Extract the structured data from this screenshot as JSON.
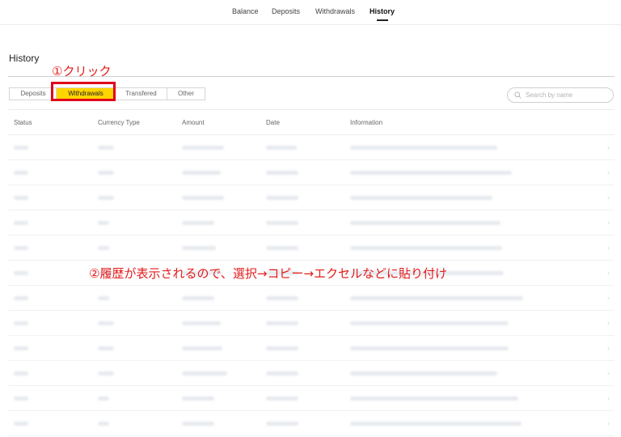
{
  "nav": {
    "tabs": [
      {
        "label": "Balance"
      },
      {
        "label": "Deposits"
      },
      {
        "label": "Withdrawals"
      },
      {
        "label": "History",
        "active": true
      }
    ]
  },
  "page": {
    "title": "History"
  },
  "annotations": {
    "step1": "①クリック",
    "step2": "②履歴が表示されるので、選択→コピー→エクセルなどに貼り付け",
    "color": "#e31b1b"
  },
  "filters": {
    "tabs": [
      {
        "label": "Deposits"
      },
      {
        "label": "Withdrawals",
        "selected": true
      },
      {
        "label": "Transfered"
      },
      {
        "label": "Other"
      }
    ],
    "selected_color": "#ffd500",
    "highlight_color": "#e0001b"
  },
  "search": {
    "placeholder": "Search by name",
    "icon": "search-icon"
  },
  "table": {
    "columns": [
      "Status",
      "Currency Type",
      "Amount",
      "Date",
      "Information"
    ],
    "row_count": 12,
    "rows_blurred": true
  }
}
